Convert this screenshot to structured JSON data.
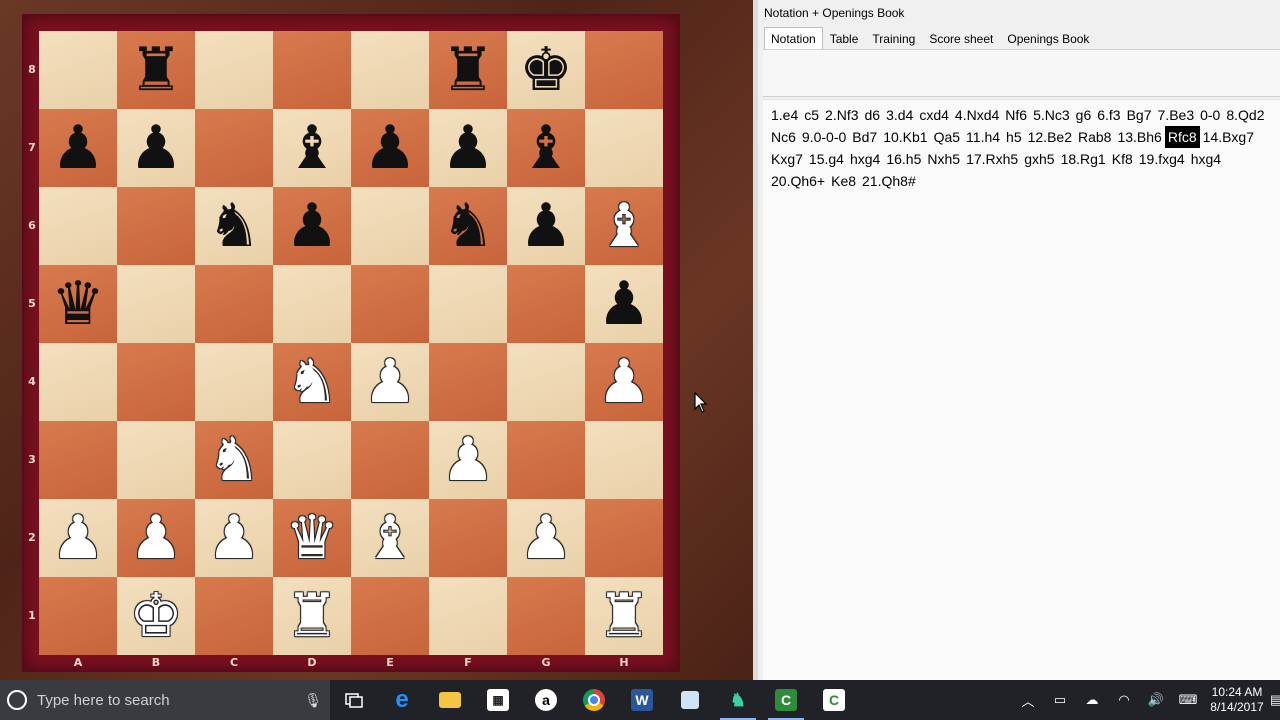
{
  "board": {
    "ranks": [
      "8",
      "7",
      "6",
      "5",
      "4",
      "3",
      "2",
      "1"
    ],
    "files": [
      "A",
      "B",
      "C",
      "D",
      "E",
      "F",
      "G",
      "H"
    ],
    "squares": [
      [
        null,
        "br",
        null,
        null,
        null,
        "br",
        "bk",
        null
      ],
      [
        "bp",
        "bp",
        null,
        "bb",
        "bp",
        "bp",
        "bb",
        null
      ],
      [
        null,
        null,
        "bn",
        "bp",
        null,
        "bn",
        "bp",
        "wb"
      ],
      [
        "bq",
        null,
        null,
        null,
        null,
        null,
        null,
        "bp"
      ],
      [
        null,
        null,
        null,
        "wn",
        "wp",
        null,
        null,
        "wp"
      ],
      [
        null,
        null,
        "wn",
        null,
        null,
        "wp",
        null,
        null
      ],
      [
        "wp",
        "wp",
        "wp",
        "wq",
        "wb",
        null,
        "wp",
        null
      ],
      [
        null,
        "wk",
        null,
        "wr",
        null,
        null,
        null,
        "wr"
      ]
    ],
    "glyphs": {
      "k": "♚",
      "q": "♛",
      "r": "♜",
      "b": "♝",
      "n": "♞",
      "p": "♟"
    }
  },
  "panel": {
    "title": "Notation + Openings Book",
    "tabs": [
      "Notation",
      "Table",
      "Training",
      "Score sheet",
      "Openings Book"
    ],
    "active_tab": 0
  },
  "notation": {
    "moves": [
      "1.e4",
      "c5",
      "2.Nf3",
      "d6",
      "3.d4",
      "cxd4",
      "4.Nxd4",
      "Nf6",
      "5.Nc3",
      "g6",
      "6.f3",
      "Bg7",
      "7.Be3",
      "0-0",
      "8.Qd2",
      "Nc6",
      "9.0-0-0",
      "Bd7",
      "10.Kb1",
      "Qa5",
      "11.h4",
      "h5",
      "12.Be2",
      "Rab8",
      "13.Bh6",
      "Rfc8",
      "14.Bxg7",
      "Kxg7",
      "15.g4",
      "hxg4",
      "16.h5",
      "Nxh5",
      "17.Rxh5",
      "gxh5",
      "18.Rg1",
      "Kf8",
      "19.fxg4",
      "hxg4",
      "20.Qh6+",
      "Ke8",
      "21.Qh8#"
    ],
    "selected": 25
  },
  "taskbar": {
    "search_placeholder": "Type here to search",
    "icons": [
      "task-view-icon",
      "edge-icon",
      "file-explorer-icon",
      "store-icon",
      "amazon-icon",
      "chrome-icon",
      "word-icon",
      "notepad-icon",
      "chess-app-icon",
      "camtasia-icon",
      "camtasia-recorder-icon"
    ],
    "time": "10:24 AM",
    "date": "8/14/2017"
  }
}
